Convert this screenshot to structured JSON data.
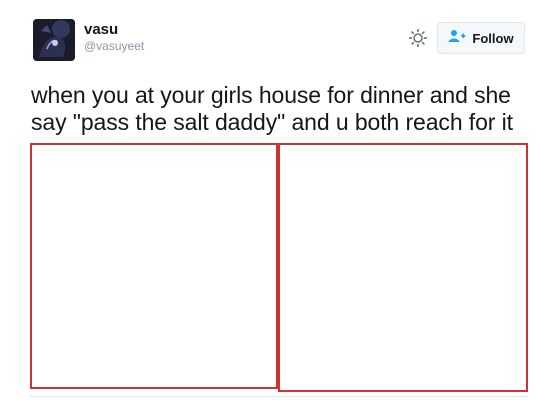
{
  "user": {
    "display_name": "vasu",
    "handle": "@vasuyeet",
    "avatar_icon": "profile-avatar"
  },
  "actions": {
    "settings_icon": "gear-icon",
    "follow_label": "Follow",
    "follow_icon": "add-user-icon",
    "accent_color": "#1da1f2"
  },
  "tweet": {
    "text": "when you at your girls house for dinner and she say \"pass the salt daddy\" and u both reach for it"
  },
  "media": {
    "panel_count": 2,
    "border_color": "#cc3333"
  }
}
